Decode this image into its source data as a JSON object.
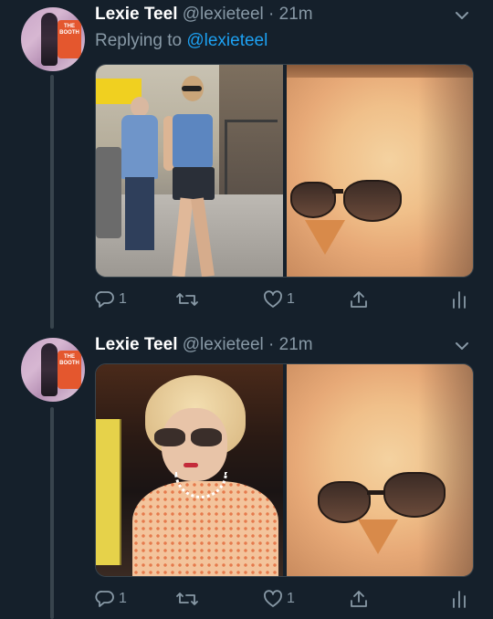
{
  "tweets": [
    {
      "name": "Lexie Teel",
      "handle": "@lexieteel",
      "time": "· 21m",
      "replying_prefix": "Replying to",
      "replying_to": "@lexieteel",
      "avatar_text": "THE BOOTH",
      "reply_count": "1",
      "retweet_count": "",
      "like_count": "1"
    },
    {
      "name": "Lexie Teel",
      "handle": "@lexieteel",
      "time": "· 21m",
      "avatar_text": "THE BOOTH",
      "reply_count": "1",
      "retweet_count": "",
      "like_count": "1"
    }
  ],
  "icons": [
    "chevron-down-icon",
    "reply-icon",
    "retweet-icon",
    "like-icon",
    "share-icon",
    "analytics-icon"
  ],
  "colors": {
    "background": "#15202b",
    "muted": "#8899a6",
    "link": "#1da1f2",
    "divider": "#38444d"
  }
}
